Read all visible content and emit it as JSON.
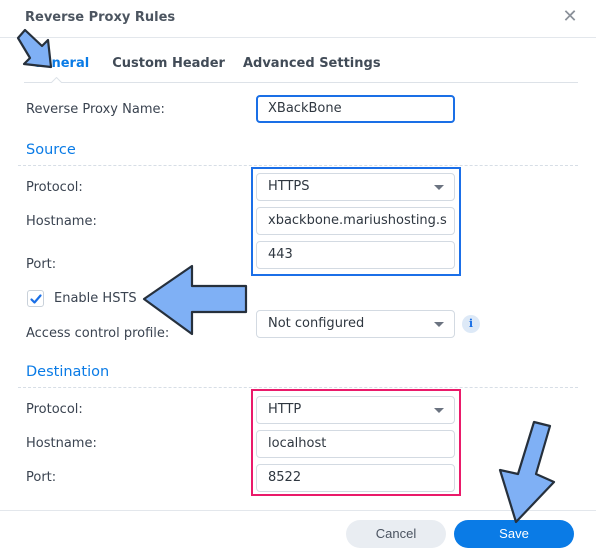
{
  "dialog": {
    "title": "Reverse Proxy Rules",
    "close_icon": "close-icon"
  },
  "tabs": [
    {
      "label": "General",
      "active": true
    },
    {
      "label": "Custom Header",
      "active": false
    },
    {
      "label": "Advanced Settings",
      "active": false
    }
  ],
  "general": {
    "name_label": "Reverse Proxy Name:",
    "name_value": "XBackBone"
  },
  "source": {
    "heading": "Source",
    "protocol_label": "Protocol:",
    "protocol_value": "HTTPS",
    "hostname_label": "Hostname:",
    "hostname_value": "xbackbone.mariushosting.s",
    "port_label": "Port:",
    "port_value": "443",
    "hsts_label": "Enable HSTS",
    "hsts_checked": true,
    "access_label": "Access control profile:",
    "access_value": "Not configured",
    "info_icon": "i"
  },
  "destination": {
    "heading": "Destination",
    "protocol_label": "Protocol:",
    "protocol_value": "HTTP",
    "hostname_label": "Hostname:",
    "hostname_value": "localhost",
    "port_label": "Port:",
    "port_value": "8522"
  },
  "footer": {
    "cancel_label": "Cancel",
    "save_label": "Save"
  },
  "colors": {
    "accent": "#0a7be6",
    "highlight_source": "#1b6fe8",
    "highlight_destination": "#ea1a6a",
    "annotation_arrow": "#7fb0f5"
  }
}
